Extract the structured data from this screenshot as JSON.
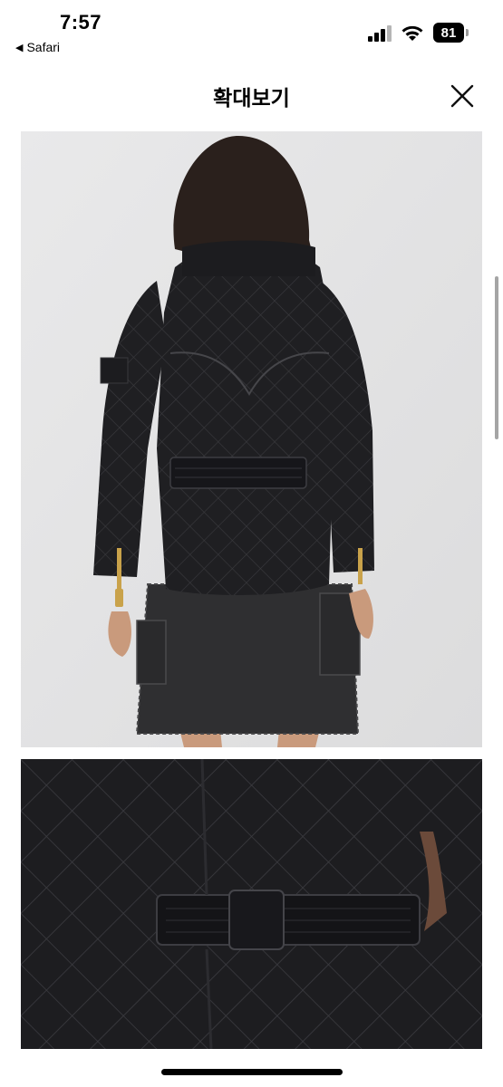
{
  "status_bar": {
    "time": "7:57",
    "back_app": "Safari",
    "battery": "81",
    "signal_icon": "cellular-signal-icon",
    "wifi_icon": "wifi-icon",
    "battery_icon": "battery-icon"
  },
  "nav": {
    "title": "확대보기",
    "close_icon": "close-icon"
  },
  "images": [
    {
      "description_icon": "product-photo",
      "kind": "back view"
    },
    {
      "description_icon": "product-photo",
      "kind": "detail"
    }
  ],
  "colors": {
    "background": "#ffffff",
    "photo_background": "#e3e3e4",
    "jacket": "#1c1c1e",
    "denim": "#2e2e30",
    "gold_zip": "#c9a24a"
  }
}
